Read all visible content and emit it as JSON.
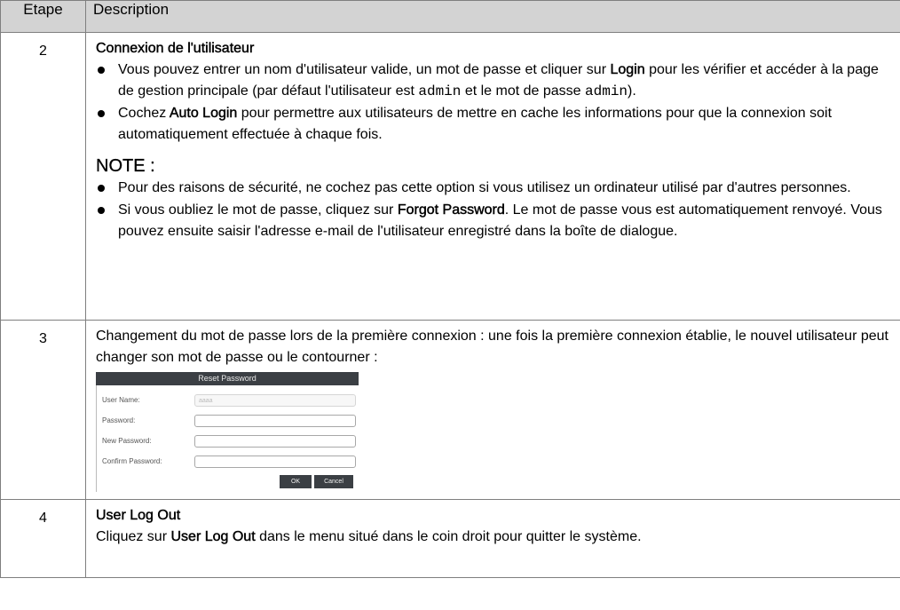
{
  "table": {
    "header": {
      "step": "Etape",
      "description": "Description"
    },
    "rows": [
      {
        "step": "2",
        "title": "Connexion de l'utilisateur",
        "bullets": [
          {
            "t1": "Vous pouvez entrer un nom d'utilisateur valide, un mot de passe et cliquer sur ",
            "b1": "Login",
            "t2": " pour les vérifier et accéder à la page de gestion principale (par défaut l'utilisateur est ",
            "code1": "admin",
            "t3": " et le mot de passe ",
            "code2": "admin",
            "t4": ")."
          },
          {
            "t1": "Cochez ",
            "b1": "Auto Login",
            "t2": " pour permettre aux utilisateurs de mettre en cache les informations pour que la connexion soit automatiquement effectuée à chaque fois."
          }
        ],
        "note_heading": "NOTE :",
        "note_bullets": [
          {
            "t1": "Pour des raisons de sécurité, ne cochez pas cette option si vous utilisez un ordinateur utilisé par d'autres personnes."
          },
          {
            "t1": "Si vous oubliez le mot de passe, cliquez sur ",
            "b1": "Forgot Password",
            "t2": ". Le mot de passe vous est automatiquement renvoyé. Vous pouvez ensuite saisir l'adresse e-mail de l'utilisateur enregistré dans la boîte de dialogue."
          }
        ]
      },
      {
        "step": "3",
        "text": "Changement du mot de passe lors de la première connexion : une fois la première connexion établie, le nouvel utilisateur peut changer son mot de passe ou le contourner :",
        "dialog": {
          "title": "Reset Password",
          "fields": [
            {
              "label": "User Name:",
              "value": "aaaa"
            },
            {
              "label": "Password:",
              "value": ""
            },
            {
              "label": "New Password:",
              "value": ""
            },
            {
              "label": "Confirm Password:",
              "value": ""
            }
          ],
          "ok_label": "OK",
          "cancel_label": "Cancel"
        }
      },
      {
        "step": "4",
        "title": "User Log Out",
        "t1": "Cliquez sur ",
        "b1": "User Log Out",
        "t2": " dans le menu situé dans le coin droit pour quitter le système."
      }
    ]
  }
}
